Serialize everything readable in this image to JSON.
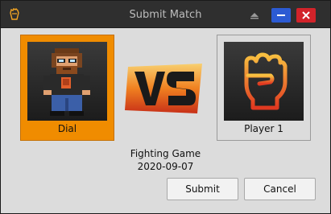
{
  "window": {
    "title": "Submit Match"
  },
  "players": {
    "left": {
      "name": "Dial",
      "selected": true,
      "icon": "pixel-avatar-icon"
    },
    "right": {
      "name": "Player 1",
      "selected": false,
      "icon": "fist-icon"
    }
  },
  "versus": {
    "icon": "vs-icon"
  },
  "match": {
    "game": "Fighting Game",
    "date": "2020-09-07"
  },
  "buttons": {
    "submit": "Submit",
    "cancel": "Cancel"
  },
  "colors": {
    "selected_card": "#f08c00",
    "accent_orange": "#f5a623",
    "titlebar": "#2f2f2f",
    "minimize": "#2c5bd3",
    "close": "#d2232a"
  }
}
